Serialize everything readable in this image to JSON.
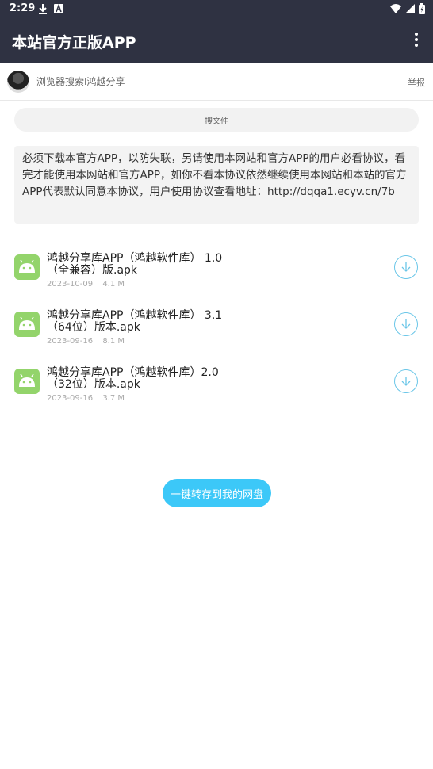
{
  "status_bar": {
    "time": "2:29"
  },
  "app_bar": {
    "title": "本站官方正版APP"
  },
  "user": {
    "name": "浏览器搜索I鸿越分享",
    "report_label": "举报"
  },
  "search": {
    "placeholder": "搜文件"
  },
  "notice": {
    "text": "必须下载本官方APP，以防失联，另请使用本网站和官方APP的用户必看协议，看完才能使用本网站和官方APP，如你不看本协议依然继续使用本网站和本站的官方APP代表默认同意本协议，用户使用协议查看地址：http://dqqa1.ecyv.cn/7b"
  },
  "files": [
    {
      "name_line1": "鸿越分享库APP（鸿越软件库） 1.0",
      "name_line2": "（全兼容）版.apk",
      "date": "2023-10-09",
      "size": "4.1 M"
    },
    {
      "name_line1": "鸿越分享库APP（鸿越软件库） 3.1",
      "name_line2": "（64位）版本.apk",
      "date": "2023-09-16",
      "size": "8.1 M"
    },
    {
      "name_line1": "鸿越分享库APP（鸿越软件库）2.0",
      "name_line2": "（32位）版本.apk",
      "date": "2023-09-16",
      "size": "3.7 M"
    }
  ],
  "actions": {
    "save_to_drive": "一键转存到我的网盘"
  },
  "colors": {
    "header": "#2f3242",
    "accent": "#3cc8f8",
    "android": "#93d46b"
  }
}
